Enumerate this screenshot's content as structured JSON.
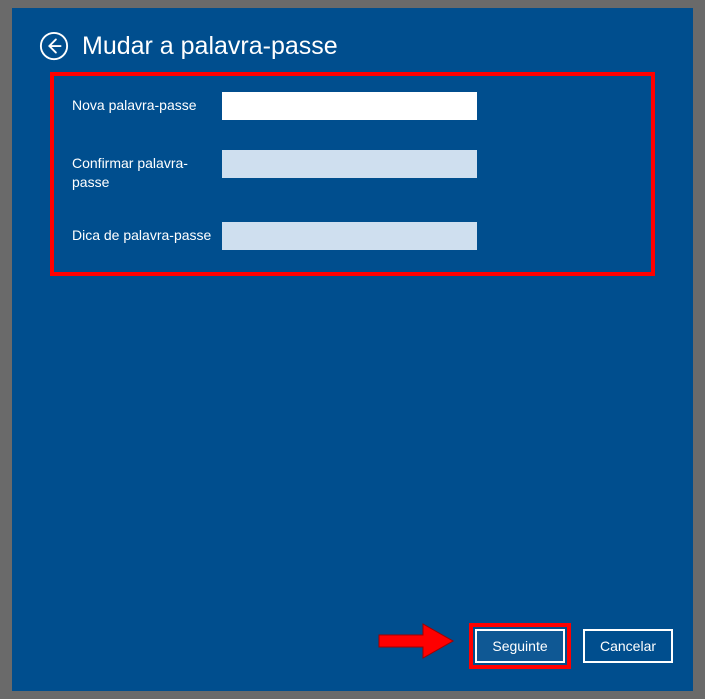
{
  "header": {
    "title": "Mudar a palavra-passe"
  },
  "form": {
    "new_password_label": "Nova palavra-passe",
    "confirm_password_label": "Confirmar palavra-passe",
    "hint_label": "Dica de palavra-passe",
    "new_password_value": "",
    "confirm_password_value": "",
    "hint_value": ""
  },
  "footer": {
    "next_label": "Seguinte",
    "cancel_label": "Cancelar"
  }
}
